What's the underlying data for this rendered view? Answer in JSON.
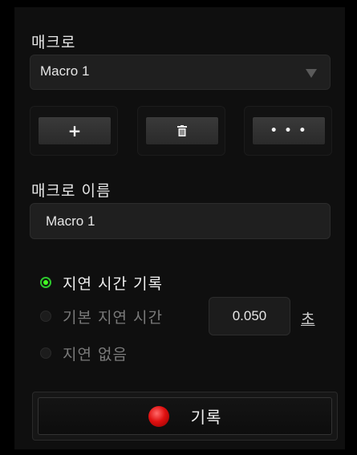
{
  "macro_section": {
    "label": "매크로"
  },
  "macro_select": {
    "value": "Macro 1"
  },
  "buttons": {
    "add": "+",
    "delete": "🗑",
    "more": "• • •"
  },
  "name_section": {
    "label": "매크로 이름"
  },
  "name_input": {
    "value": "Macro 1"
  },
  "delay_options": [
    {
      "label": "지연 시간 기록",
      "selected": true
    },
    {
      "label": "기본 지연 시간",
      "selected": false
    },
    {
      "label": "지연 없음",
      "selected": false
    }
  ],
  "default_delay": {
    "value": "0.050",
    "unit": "초"
  },
  "record_button": {
    "label": "기록"
  },
  "colors": {
    "radio_selected": "#44ff22",
    "record_dot": "#e01010"
  }
}
